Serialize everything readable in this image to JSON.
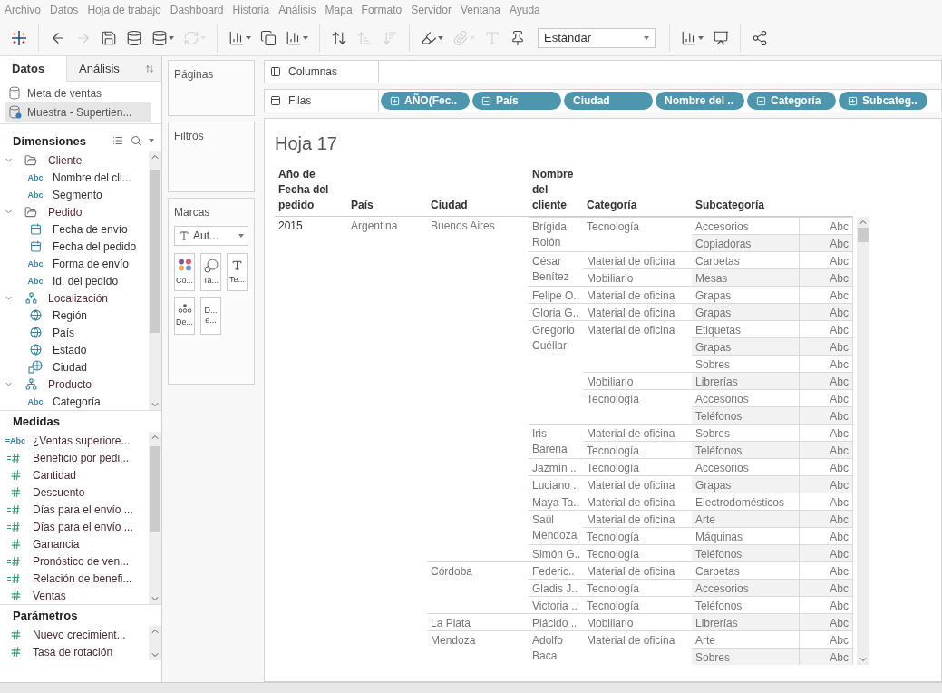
{
  "menu": [
    {
      "label": "Archivo"
    },
    {
      "label": "Datos"
    },
    {
      "label": "Hoja de trabajo"
    },
    {
      "label": "Dashboard"
    },
    {
      "label": "Historia"
    },
    {
      "label": "Análisis"
    },
    {
      "label": "Mapa"
    },
    {
      "label": "Formato"
    },
    {
      "label": "Servidor"
    },
    {
      "label": "Ventana"
    },
    {
      "label": "Ayuda"
    }
  ],
  "toolbar": {
    "groups": [
      [
        {
          "kind": "icon",
          "disabled": false,
          "menu": false
        }
      ],
      [
        {
          "kind": "icon",
          "disabled": false,
          "menu": false
        },
        {
          "kind": "icon",
          "disabled": true,
          "menu": false
        },
        {
          "kind": "icon",
          "disabled": false,
          "menu": false
        },
        {
          "kind": "icon",
          "disabled": false,
          "menu": false
        },
        {
          "kind": "icon",
          "disabled": false,
          "menu": true
        },
        {
          "kind": "icon",
          "disabled": true,
          "menu": true
        }
      ],
      [
        {
          "kind": "icon",
          "disabled": false,
          "menu": true
        },
        {
          "kind": "icon",
          "disabled": false,
          "menu": false
        },
        {
          "kind": "icon",
          "disabled": false,
          "menu": true
        }
      ],
      [
        {
          "kind": "icon",
          "disabled": false,
          "menu": false
        },
        {
          "kind": "icon",
          "disabled": true,
          "menu": false
        },
        {
          "kind": "icon",
          "disabled": true,
          "menu": false
        }
      ],
      [
        {
          "kind": "icon",
          "disabled": false,
          "menu": true
        },
        {
          "kind": "icon",
          "disabled": true,
          "menu": true
        },
        {
          "kind": "icon",
          "disabled": true,
          "menu": false
        },
        {
          "kind": "icon",
          "disabled": false,
          "menu": false
        },
        {
          "kind": "dropdown",
          "label": "Estándar"
        }
      ],
      [
        {
          "kind": "icon",
          "disabled": false,
          "menu": true
        },
        {
          "kind": "icon",
          "disabled": false,
          "menu": false
        }
      ],
      [
        {
          "kind": "icon",
          "disabled": false,
          "menu": false
        }
      ]
    ]
  },
  "data_pane": {
    "tabs": [
      {
        "label": "Datos",
        "selected": true
      },
      {
        "label": "Análisis",
        "selected": false
      }
    ],
    "sources": [
      {
        "name": "Meta de ventas",
        "selected": false
      },
      {
        "name": "Muestra - Supertien...",
        "selected": true
      }
    ],
    "dimensions": {
      "title": "Dimensiones",
      "items": [
        {
          "name": "Cliente",
          "kind": "folder",
          "expanded": true,
          "children": [
            {
              "name": "Nombre del cli...",
              "kind": "text",
              "type_mark": "Abc"
            },
            {
              "name": "Segmento",
              "kind": "text",
              "type_mark": "Abc"
            }
          ]
        },
        {
          "name": "Pedido",
          "kind": "folder",
          "expanded": true,
          "children": [
            {
              "name": "Fecha de envío",
              "kind": "date"
            },
            {
              "name": "Fecha del pedido",
              "kind": "date"
            },
            {
              "name": "Forma de envío",
              "kind": "text",
              "type_mark": "Abc"
            },
            {
              "name": "Id. del pedido",
              "kind": "text",
              "type_mark": "Abc"
            }
          ]
        },
        {
          "name": "Localización",
          "kind": "hierarchy",
          "expanded": true,
          "children": [
            {
              "name": "Región",
              "kind": "geo"
            },
            {
              "name": "País",
              "kind": "geo"
            },
            {
              "name": "Estado",
              "kind": "geo"
            },
            {
              "name": "Ciudad",
              "kind": "geo-link"
            }
          ]
        },
        {
          "name": "Producto",
          "kind": "hierarchy",
          "expanded": true,
          "children": [
            {
              "name": "Categoría",
              "kind": "text",
              "type_mark": "Abc"
            }
          ]
        }
      ]
    },
    "measures": {
      "title": "Medidas",
      "items": [
        {
          "name": "¿Ventas superiore...",
          "kind": "calc-text",
          "type_mark": "=Abc"
        },
        {
          "name": "Beneficio por pedi...",
          "kind": "calc"
        },
        {
          "name": "Cantidad",
          "kind": "number"
        },
        {
          "name": "Descuento",
          "kind": "number"
        },
        {
          "name": "Días para el envío ...",
          "kind": "calc"
        },
        {
          "name": "Días para el envío ...",
          "kind": "calc"
        },
        {
          "name": "Ganancia",
          "kind": "number"
        },
        {
          "name": "Pronóstico de ven...",
          "kind": "calc"
        },
        {
          "name": "Relación de benefi...",
          "kind": "calc"
        },
        {
          "name": "Ventas",
          "kind": "number"
        }
      ]
    },
    "parameters": {
      "title": "Parámetros",
      "items": [
        {
          "name": "Nuevo crecimient...",
          "kind": "number"
        },
        {
          "name": "Tasa de rotación",
          "kind": "number"
        }
      ]
    }
  },
  "pages_shelf": {
    "title": "Páginas"
  },
  "filters_shelf": {
    "title": "Filtros"
  },
  "marks": {
    "title": "Marcas",
    "mark_type": "Aut...",
    "cards": [
      {
        "label": "Co...",
        "kind": "color"
      },
      {
        "label": "Ta...",
        "kind": "size"
      },
      {
        "label": "Te...",
        "kind": "text"
      },
      {
        "label": "De...",
        "kind": "detail"
      },
      {
        "label": "D... e...",
        "kind": "tooltip"
      }
    ]
  },
  "columns_shelf": {
    "title": "Columnas"
  },
  "rows_shelf": {
    "title": "Filas",
    "pills": [
      {
        "label": "AÑO(Fec..",
        "kind": "expand"
      },
      {
        "label": "País",
        "kind": "collapse"
      },
      {
        "label": "Ciudad",
        "kind": "plain"
      },
      {
        "label": "Nombre del ..",
        "kind": "plain"
      },
      {
        "label": "Categoría",
        "kind": "collapse"
      },
      {
        "label": "Subcateg..",
        "kind": "expand"
      }
    ]
  },
  "sheet": {
    "title": "Hoja 17",
    "headers": [
      "Año de Fecha del pedido",
      "País",
      "Ciudad",
      "Nombre del cliente",
      "Categoría",
      "Subcategoría"
    ],
    "rows": [
      {
        "year": "2015",
        "countries": [
          {
            "name": "Argentina",
            "cities": [
              {
                "name": "Buenos Aires",
                "customers": [
                  {
                    "name": "Brígida Rolón",
                    "categories": [
                      {
                        "name": "Tecnología",
                        "subcategories": [
                          {
                            "name": "Accesorios",
                            "value": "Abc"
                          },
                          {
                            "name": "Copiadoras",
                            "value": "Abc"
                          }
                        ]
                      }
                    ]
                  },
                  {
                    "name": "César Benítez",
                    "categories": [
                      {
                        "name": "Material de oficina",
                        "subcategories": [
                          {
                            "name": "Carpetas",
                            "value": "Abc"
                          }
                        ]
                      },
                      {
                        "name": "Mobiliario",
                        "subcategories": [
                          {
                            "name": "Mesas",
                            "value": "Abc"
                          }
                        ]
                      }
                    ]
                  },
                  {
                    "name": "Felipe O..",
                    "categories": [
                      {
                        "name": "Material de oficina",
                        "subcategories": [
                          {
                            "name": "Grapas",
                            "value": "Abc"
                          }
                        ]
                      }
                    ]
                  },
                  {
                    "name": "Gloria G..",
                    "categories": [
                      {
                        "name": "Material de oficina",
                        "subcategories": [
                          {
                            "name": "Grapas",
                            "value": "Abc"
                          }
                        ]
                      }
                    ]
                  },
                  {
                    "name": "Gregorio Cuéllar",
                    "categories": [
                      {
                        "name": "Material de oficina",
                        "subcategories": [
                          {
                            "name": "Etiquetas",
                            "value": "Abc"
                          },
                          {
                            "name": "Grapas",
                            "value": "Abc"
                          },
                          {
                            "name": "Sobres",
                            "value": "Abc"
                          }
                        ]
                      },
                      {
                        "name": "Mobiliario",
                        "subcategories": [
                          {
                            "name": "Librerías",
                            "value": "Abc"
                          }
                        ]
                      },
                      {
                        "name": "Tecnología",
                        "subcategories": [
                          {
                            "name": "Accesorios",
                            "value": "Abc"
                          },
                          {
                            "name": "Teléfonos",
                            "value": "Abc"
                          }
                        ]
                      }
                    ]
                  },
                  {
                    "name": "Iris Barena",
                    "categories": [
                      {
                        "name": "Material de oficina",
                        "subcategories": [
                          {
                            "name": "Sobres",
                            "value": "Abc"
                          }
                        ]
                      },
                      {
                        "name": "Tecnología",
                        "subcategories": [
                          {
                            "name": "Teléfonos",
                            "value": "Abc"
                          }
                        ]
                      }
                    ]
                  },
                  {
                    "name": "Jazmín ..",
                    "categories": [
                      {
                        "name": "Tecnología",
                        "subcategories": [
                          {
                            "name": "Accesorios",
                            "value": "Abc"
                          }
                        ]
                      }
                    ]
                  },
                  {
                    "name": "Luciano ..",
                    "categories": [
                      {
                        "name": "Material de oficina",
                        "subcategories": [
                          {
                            "name": "Grapas",
                            "value": "Abc"
                          }
                        ]
                      }
                    ]
                  },
                  {
                    "name": "Maya Ta..",
                    "categories": [
                      {
                        "name": "Material de oficina",
                        "subcategories": [
                          {
                            "name": "Electrodomésticos",
                            "value": "Abc"
                          }
                        ]
                      }
                    ]
                  },
                  {
                    "name": "Saúl Mendoza",
                    "categories": [
                      {
                        "name": "Material de oficina",
                        "subcategories": [
                          {
                            "name": "Arte",
                            "value": "Abc"
                          }
                        ]
                      },
                      {
                        "name": "Tecnología",
                        "subcategories": [
                          {
                            "name": "Máquinas",
                            "value": "Abc"
                          }
                        ]
                      }
                    ]
                  },
                  {
                    "name": "Simón G..",
                    "categories": [
                      {
                        "name": "Tecnología",
                        "subcategories": [
                          {
                            "name": "Teléfonos",
                            "value": "Abc"
                          }
                        ]
                      }
                    ]
                  }
                ]
              },
              {
                "name": "Córdoba",
                "customers": [
                  {
                    "name": "Federic..",
                    "categories": [
                      {
                        "name": "Material de oficina",
                        "subcategories": [
                          {
                            "name": "Carpetas",
                            "value": "Abc"
                          }
                        ]
                      }
                    ]
                  },
                  {
                    "name": "Gladis J..",
                    "categories": [
                      {
                        "name": "Tecnología",
                        "subcategories": [
                          {
                            "name": "Accesorios",
                            "value": "Abc"
                          }
                        ]
                      }
                    ]
                  },
                  {
                    "name": "Victoria ..",
                    "categories": [
                      {
                        "name": "Tecnología",
                        "subcategories": [
                          {
                            "name": "Teléfonos",
                            "value": "Abc"
                          }
                        ]
                      }
                    ]
                  }
                ]
              },
              {
                "name": "La Plata",
                "customers": [
                  {
                    "name": "Plácido ..",
                    "categories": [
                      {
                        "name": "Mobiliario",
                        "subcategories": [
                          {
                            "name": "Librerías",
                            "value": "Abc"
                          }
                        ]
                      }
                    ]
                  }
                ]
              },
              {
                "name": "Mendoza",
                "customers": [
                  {
                    "name": "Adolfo Baca",
                    "categories": [
                      {
                        "name": "Material de oficina",
                        "subcategories": [
                          {
                            "name": "Arte",
                            "value": "Abc"
                          },
                          {
                            "name": "Sobres",
                            "value": "Abc"
                          }
                        ]
                      }
                    ]
                  }
                ]
              }
            ]
          }
        ]
      }
    ]
  }
}
